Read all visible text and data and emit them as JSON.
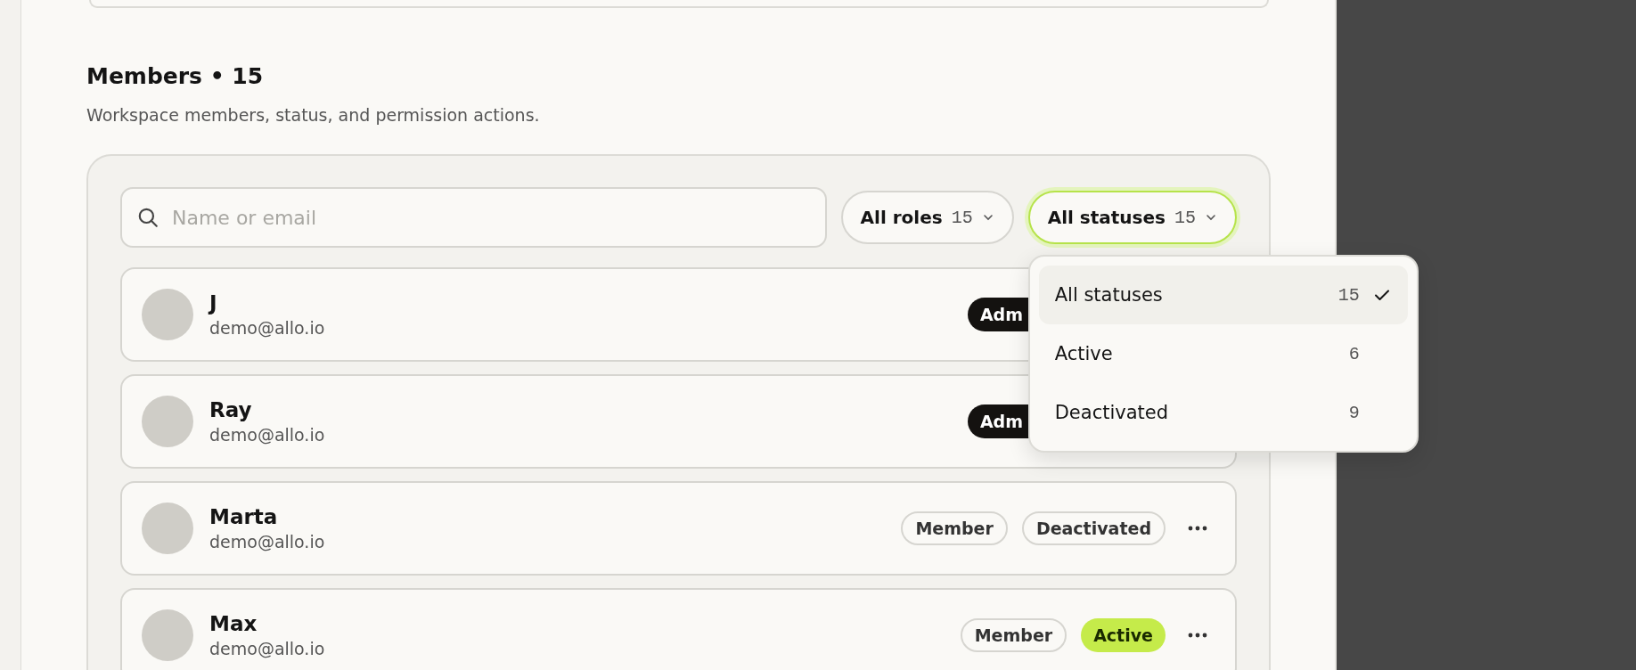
{
  "section": {
    "title": "Members • 15",
    "subtitle": "Workspace members, status, and permission actions."
  },
  "search": {
    "placeholder": "Name or email"
  },
  "filters": [
    {
      "label": "All roles",
      "count": "15",
      "focused": false
    },
    {
      "label": "All statuses",
      "count": "15",
      "focused": true,
      "menu": [
        {
          "label": "All statuses",
          "count": "15",
          "selected": true
        },
        {
          "label": "Active",
          "count": "6",
          "selected": false
        },
        {
          "label": "Deactivated",
          "count": "9",
          "selected": false
        }
      ]
    }
  ],
  "members": [
    {
      "name": "J",
      "email": "demo@allo.io",
      "badges": [
        {
          "label": "Adm",
          "kind": "dark",
          "clipped": true
        }
      ],
      "more_visible": false
    },
    {
      "name": "Ray",
      "email": "demo@allo.io",
      "badges": [
        {
          "label": "Adm",
          "kind": "dark",
          "clipped": true
        }
      ],
      "more_visible": false
    },
    {
      "name": "Marta",
      "email": "demo@allo.io",
      "badges": [
        {
          "label": "Member",
          "kind": "outline",
          "clipped": false
        },
        {
          "label": "Deactivated",
          "kind": "outline",
          "clipped": false
        }
      ],
      "more_visible": true
    },
    {
      "name": "Max",
      "email": "demo@allo.io",
      "badges": [
        {
          "label": "Member",
          "kind": "outline",
          "clipped": false
        },
        {
          "label": "Active",
          "kind": "active",
          "clipped": false
        }
      ],
      "more_visible": true
    }
  ]
}
